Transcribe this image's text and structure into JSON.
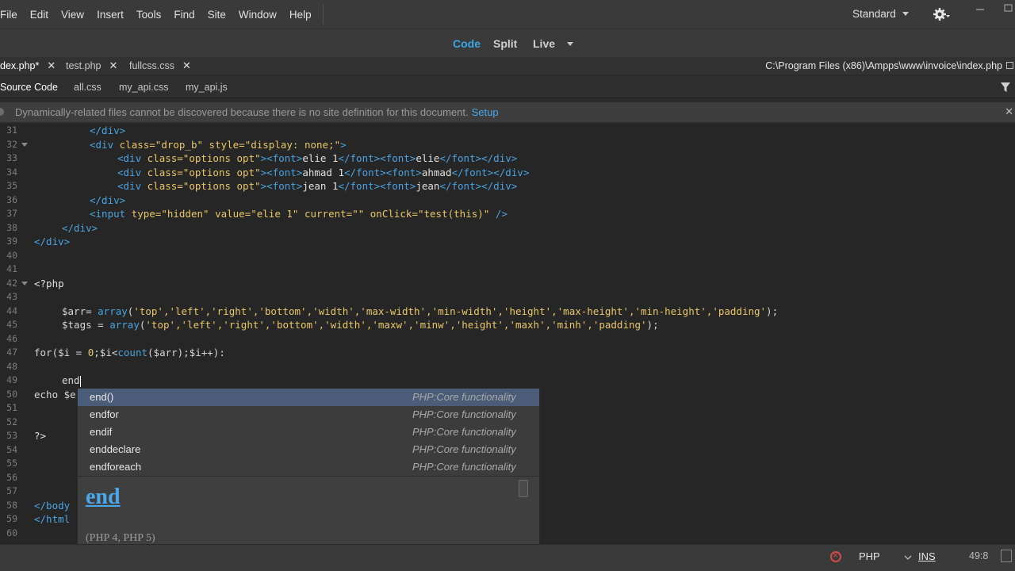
{
  "menu": [
    "File",
    "Edit",
    "View",
    "Insert",
    "Tools",
    "Find",
    "Site",
    "Window",
    "Help"
  ],
  "workspace": "Standard",
  "views": {
    "code": "Code",
    "split": "Split",
    "live": "Live"
  },
  "tabs": [
    {
      "label": "dex.php*",
      "close": "✕"
    },
    {
      "label": "test.php",
      "close": "✕"
    },
    {
      "label": "fullcss.css",
      "close": "✕"
    }
  ],
  "filepath": "C:\\Program Files (x86)\\Ampps\\www\\invoice\\index.php",
  "related": [
    "Source Code",
    "all.css",
    "my_api.css",
    "my_api.js"
  ],
  "info": {
    "message": "Dynamically-related files cannot be discovered because there is no site definition for this document.",
    "link": "Setup"
  },
  "line_numbers": [
    "31",
    "32",
    "33",
    "34",
    "35",
    "36",
    "37",
    "38",
    "39",
    "40",
    "41",
    "42",
    "43",
    "44",
    "45",
    "46",
    "47",
    "48",
    "49",
    "50",
    "51",
    "52",
    "53",
    "54",
    "55",
    "56",
    "57",
    "58",
    "59",
    "60"
  ],
  "code": {
    "l31": "</div>",
    "l32_tag": "<div ",
    "l32_a1": "class=",
    "l32_v1": "\"drop_b\"",
    "l32_a2": " style=",
    "l32_v2": "\"display: none;\"",
    "l32_end": ">",
    "opt_tag": "<div ",
    "opt_a": "class=",
    "opt_v": "\"options opt\"",
    "opt_gt": ">",
    "font_open": "<font>",
    "font_close": "</font>",
    "div_close": "</div>",
    "l33_t1": "elie 1",
    "l33_t2": "elie",
    "l34_t1": "ahmad 1",
    "l34_t2": "ahmad",
    "l35_t1": "jean 1",
    "l35_t2": "jean",
    "l36": "</div>",
    "l37_tag": "<input ",
    "l37_a1": "type=",
    "l37_v1": "\"hidden\"",
    "l37_a2": " value=",
    "l37_v2": "\"elie 1\"",
    "l37_a3": " current=",
    "l37_v3": "\"\"",
    "l37_a4": " onClick=",
    "l37_v4": "\"test(this)\"",
    "l37_end": " />",
    "l38": "</div>",
    "l39": "</div>",
    "l42": "<?php",
    "l44_a": "$arr= ",
    "l44_fn": "array",
    "l44_b": "(",
    "l44_s": "'top','left','right','bottom','width','max-width','min-width','height','max-height','min-height','padding'",
    "l44_c": ");",
    "l45_a": "$tags = ",
    "l45_fn": "array",
    "l45_b": "(",
    "l45_s": "'top','left','right','bottom','width','maxw','minw','height','maxh','minh','padding'",
    "l45_c": ");",
    "l47_a": "for($i = ",
    "l47_n": "0",
    "l47_b": ";$i<",
    "l47_fn": "count",
    "l47_c": "($arr);$i++):",
    "l49": "end",
    "l50": "echo $e",
    "l53": "?>",
    "l58": "</body",
    "l59": "</html"
  },
  "autocomplete": {
    "items": [
      {
        "name": "end()",
        "desc": "PHP:Core functionality"
      },
      {
        "name": "endfor",
        "desc": "PHP:Core functionality"
      },
      {
        "name": "endif",
        "desc": "PHP:Core functionality"
      },
      {
        "name": "enddeclare",
        "desc": "PHP:Core functionality"
      },
      {
        "name": "endforeach",
        "desc": "PHP:Core functionality"
      }
    ],
    "doc_title": "end",
    "doc_version": "(PHP 4, PHP 5)"
  },
  "status": {
    "language": "PHP",
    "mode": "INS",
    "position": "49:8"
  },
  "colors": {
    "accent": "#39a6ea",
    "tag": "#4aa3e0",
    "string": "#e9c767",
    "selection": "#4a5c78"
  }
}
